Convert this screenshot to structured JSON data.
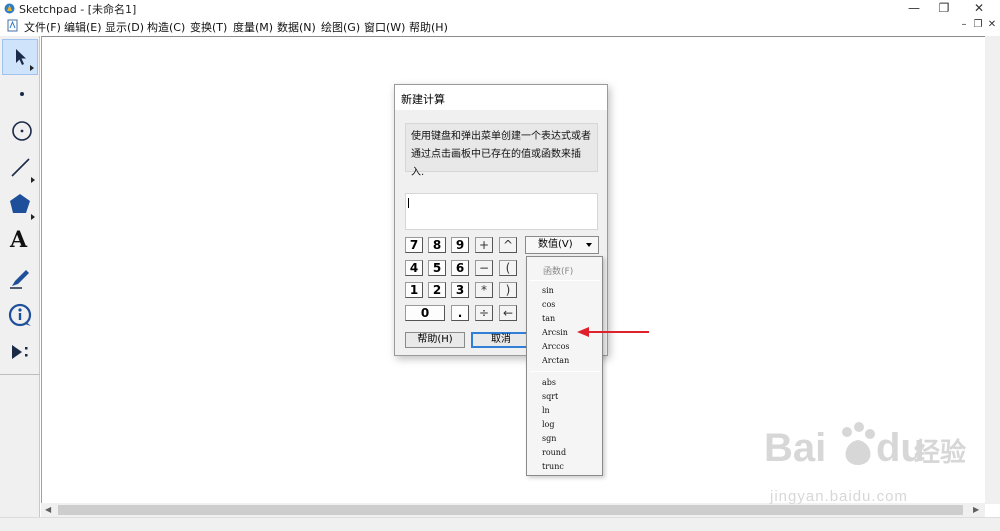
{
  "window": {
    "title": "Sketchpad  - [未命名1]",
    "controls": {
      "minimize": "—",
      "restore": "❐",
      "close": "✕"
    }
  },
  "menu": {
    "items": [
      "文件(F)",
      "编辑(E)",
      "显示(D)",
      "构造(C)",
      "变换(T)",
      "度量(M)",
      "数据(N)",
      "绘图(G)",
      "窗口(W)",
      "帮助(H)"
    ],
    "doc_controls": {
      "minimize": "–",
      "restore": "❐",
      "close": "✕"
    }
  },
  "toolbox": {
    "tools": [
      "arrow-select-tool",
      "point-tool",
      "compass-tool",
      "straightedge-tool",
      "polygon-tool",
      "text-tool",
      "marker-tool",
      "information-tool",
      "custom-tool"
    ],
    "text_tool_glyph": "A",
    "active_tool": "arrow-select-tool"
  },
  "dialog": {
    "title": "新建计算",
    "instruction": "使用键盘和弹出菜单创建一个表达式或者通过点击画板中已存在的值或函数来插入.",
    "expression": "",
    "keypad": {
      "row1": [
        "7",
        "8",
        "9",
        "+",
        "^"
      ],
      "row2": [
        "4",
        "5",
        "6",
        "−",
        "("
      ],
      "row3": [
        "1",
        "2",
        "3",
        "*",
        ")"
      ],
      "row4": [
        "0",
        ".",
        "÷",
        "←"
      ]
    },
    "values_dropdown": "数值(V)",
    "help_button": "帮助(H)",
    "cancel_button": "取消"
  },
  "popup_menu": {
    "header": "函数(F)",
    "group1": [
      "sin",
      "cos",
      "tan",
      "Arcsin",
      "Arccos",
      "Arctan"
    ],
    "group2": [
      "abs",
      "sqrt",
      "ln",
      "log",
      "sgn",
      "round",
      "trunc"
    ],
    "highlighted": "Arcsin"
  },
  "colors": {
    "arrow": "#e0202a",
    "active_tool_bg": "#cfe3fb",
    "default_button_border": "#2f7fd6"
  },
  "watermark": {
    "brand": "Bai",
    "brand_suffix": "du",
    "cn": "经验",
    "url": "jingyan.baidu.com"
  }
}
